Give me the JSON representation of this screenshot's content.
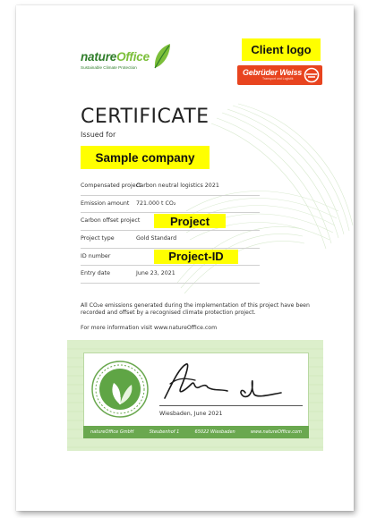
{
  "brand": {
    "name_part1": "nature",
    "name_part2": "Office",
    "tagline": "Sustainable Climate Protection"
  },
  "client_logo_label": "Client logo",
  "partner_logo": {
    "name": "Gebrüder Weiss",
    "subtitle": "Transport und Logistik"
  },
  "certificate": {
    "title": "CERTIFICATE",
    "issued_for": "Issued for",
    "company": "Sample company"
  },
  "details": [
    {
      "label": "Compensated project",
      "value": "Carbon neutral logistics 2021"
    },
    {
      "label": "Emission amount",
      "value": "721.000 t CO₂"
    },
    {
      "label": "Carbon offset project",
      "value": "Project"
    },
    {
      "label": "Project type",
      "value": "Gold Standard"
    },
    {
      "label": "ID number",
      "value": "Project-ID"
    },
    {
      "label": "Entry date",
      "value": "June 23, 2021"
    }
  ],
  "statement": "All CO₂e emissions generated during the implementation of this project have been recorded and offset by a recognised climate protection project.",
  "more_info": "For more information visit www.natureOffice.com",
  "signature_block": {
    "place_date": "Wiesbaden, June 2021"
  },
  "footer": [
    "natureOffice GmbH",
    "Steubenhof 1",
    "65022 Wiesbaden",
    "www.natureOffice.com"
  ],
  "colors": {
    "accent_green": "#6aa84f",
    "highlight_yellow": "#ffff00",
    "partner_orange": "#e8441f"
  },
  "icons": [
    "leaf-icon",
    "seal-leaves-icon",
    "truck-wheel-icon"
  ]
}
